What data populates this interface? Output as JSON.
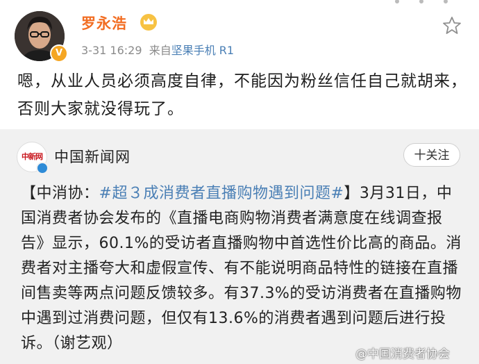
{
  "post": {
    "username": "罗永浩",
    "vip_badge": "V",
    "time": "3-31 16:29",
    "source_prefix": "来自",
    "source_device": "坚果手机 R1",
    "text": "嗯，从业人员必须高度自律，不能因为粉丝信任自己就胡来，否则大家就没得玩了。"
  },
  "repost": {
    "account_name": "中国新闻网",
    "logo_text": "中新网",
    "follow_label": "十关注",
    "text_prefix": "【中消协：",
    "hashtag": "#超３成消费者直播购物遇到问题#",
    "text_body": "】3月31日，中国消费者协会发布的《直播电商购物消费者满意度在线调查报告》显示，60.1%的受访者直播购物中首选性价比高的商品。消费者对主播夸大和虚假宣传、有不能说明商品特性的链接在直播间售卖等两点问题反馈较多。有37.3%的受访消费者在直播购物中遇到过消费问题，但仅有13.6%的消费者遇到问题后进行投诉。（谢艺观）"
  },
  "watermark": "@中国消费者协会",
  "colors": {
    "username": "#f26d22",
    "link": "#4a7fb5",
    "repost_bg": "#f1f1f1"
  },
  "icons": {
    "favorite": "star-outline-icon",
    "vip": "crown-icon"
  }
}
